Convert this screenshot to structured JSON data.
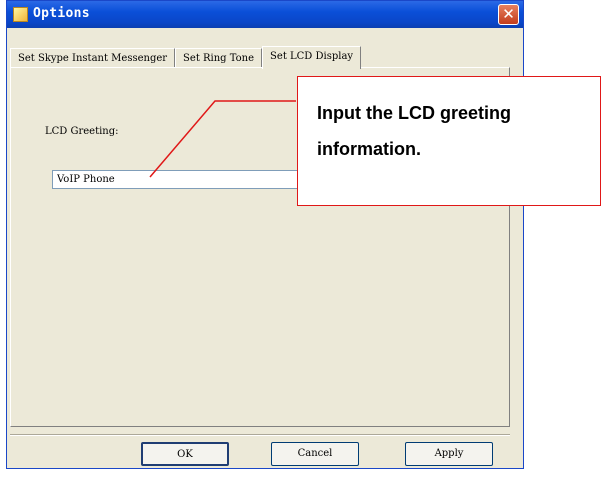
{
  "window": {
    "title": "Options",
    "close_glyph": "✕"
  },
  "tabs": [
    {
      "label": "Set Skype Instant Messenger",
      "active": false
    },
    {
      "label": "Set Ring Tone",
      "active": false
    },
    {
      "label": "Set LCD Display",
      "active": true
    }
  ],
  "lcd": {
    "label": "LCD Greeting:",
    "value": "VoIP Phone"
  },
  "buttons": {
    "ok": "OK",
    "cancel": "Cancel",
    "apply": "Apply"
  },
  "callout": {
    "text": "Input the LCD greeting information.",
    "border_color": "#e01818"
  },
  "colors": {
    "titlebar": "#0a4fd8",
    "dialog_bg": "#ece9d8"
  }
}
